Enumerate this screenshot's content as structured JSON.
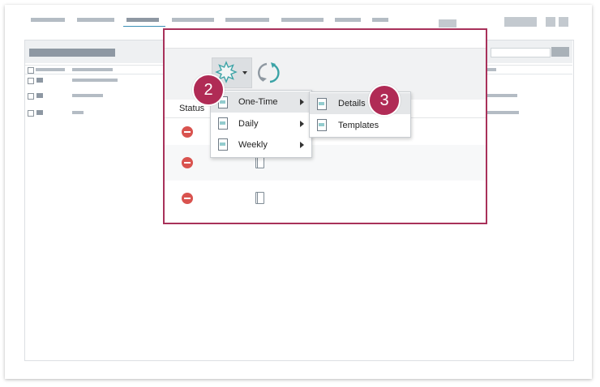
{
  "table": {
    "status_header": "Status"
  },
  "menu": {
    "items": [
      {
        "label": "One-Time",
        "icon": "report-document-icon"
      },
      {
        "label": "Daily",
        "icon": "report-document-icon"
      },
      {
        "label": "Weekly",
        "icon": "report-document-icon"
      }
    ]
  },
  "submenu": {
    "items": [
      {
        "label": "Details",
        "icon": "report-document-icon"
      },
      {
        "label": "Templates",
        "icon": "report-document-icon"
      }
    ]
  },
  "callouts": {
    "step2": "2",
    "step3": "3"
  },
  "colors": {
    "accent": "#a8315a",
    "callout": "#b02b55",
    "status_red": "#d9534f",
    "refresh_teal": "#3ba3a6"
  }
}
